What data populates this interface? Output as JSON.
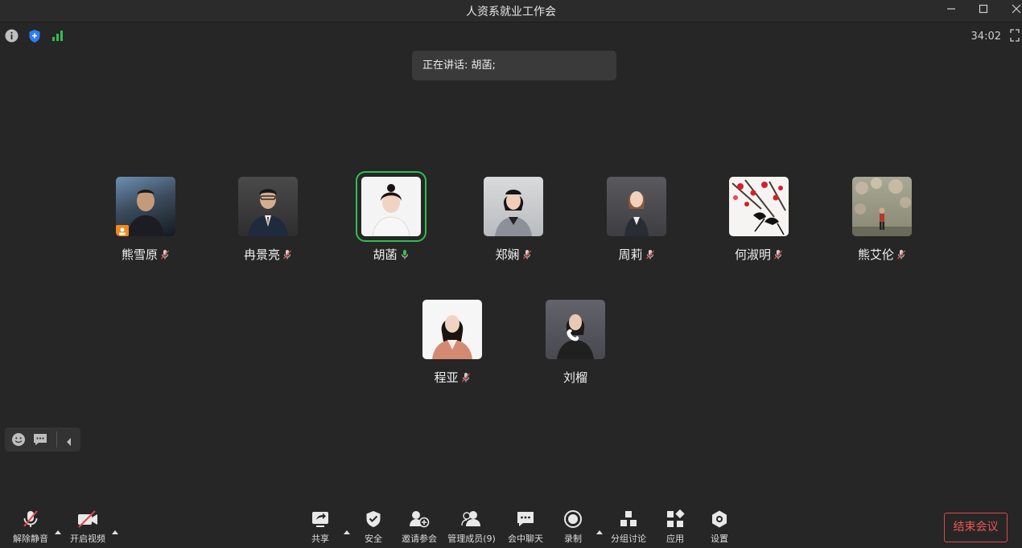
{
  "window": {
    "title": "人资系就业工作会"
  },
  "status": {
    "timer": "34:02",
    "speaking_label": "正在讲话: 胡菡;"
  },
  "participants_row1": [
    {
      "name": "熊雪原",
      "mic": "muted",
      "host": true
    },
    {
      "name": "冉景亮",
      "mic": "muted"
    },
    {
      "name": "胡菡",
      "mic": "speaking",
      "active": true
    },
    {
      "name": "郑娴",
      "mic": "muted"
    },
    {
      "name": "周莉",
      "mic": "muted"
    },
    {
      "name": "何淑明",
      "mic": "muted"
    },
    {
      "name": "熊艾伦",
      "mic": "muted"
    }
  ],
  "participants_row2": [
    {
      "name": "程亚",
      "mic": "muted"
    },
    {
      "name": "刘榴",
      "mic": "phone"
    }
  ],
  "toolbar": {
    "unmute": "解除静音",
    "start_video": "开启视频",
    "share": "共享",
    "security": "安全",
    "invite": "邀请参会",
    "manage": "管理成员(9)",
    "chat": "会中聊天",
    "record": "录制",
    "breakout": "分组讨论",
    "apps": "应用",
    "settings": "设置",
    "end": "结束会议"
  },
  "colors": {
    "background": "#262626",
    "active_speaker": "#2fbf4c",
    "end_button": "#e04848",
    "signal": "#2fbf4c",
    "shield": "#2d7cf6"
  }
}
